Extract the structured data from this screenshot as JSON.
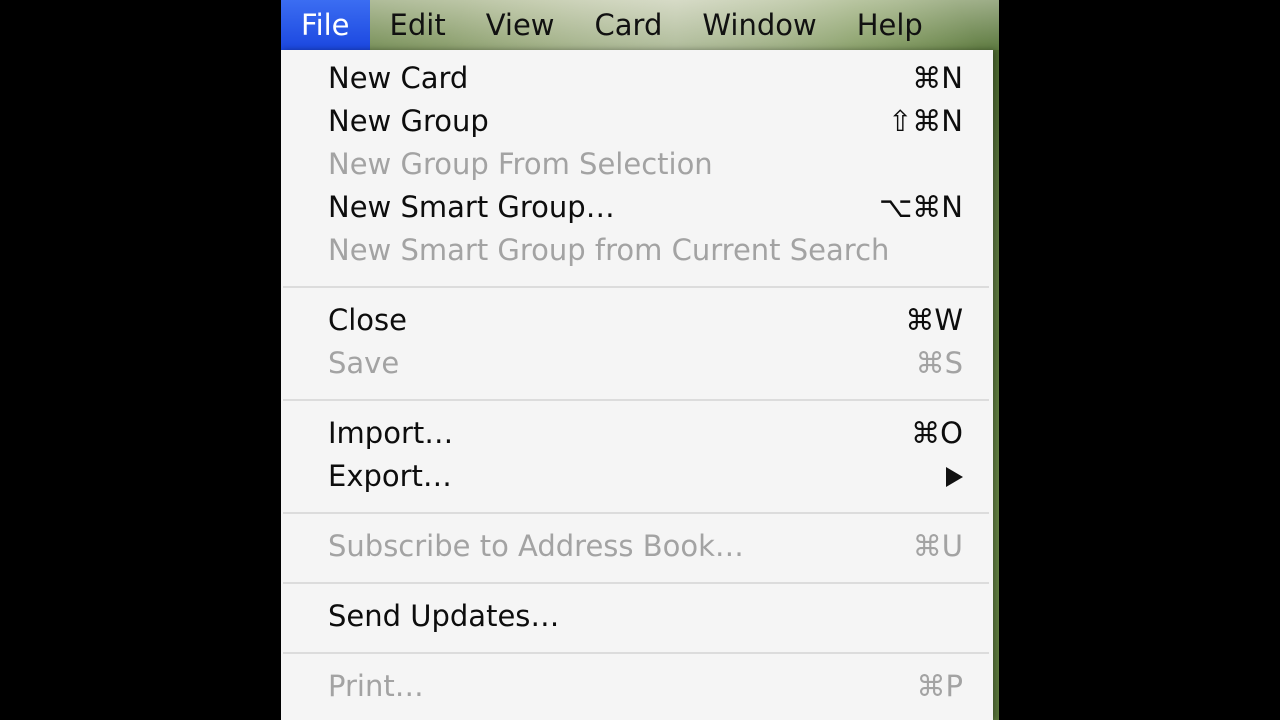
{
  "menubar": {
    "items": [
      {
        "label": "File",
        "active": true
      },
      {
        "label": "Edit",
        "active": false
      },
      {
        "label": "View",
        "active": false
      },
      {
        "label": "Card",
        "active": false
      },
      {
        "label": "Window",
        "active": false
      },
      {
        "label": "Help",
        "active": false
      }
    ]
  },
  "file_menu": {
    "items": [
      {
        "label": "New Card",
        "shortcut": "⌘N",
        "enabled": true
      },
      {
        "label": "New Group",
        "shortcut": "⇧⌘N",
        "enabled": true
      },
      {
        "label": "New Group From Selection",
        "shortcut": "",
        "enabled": false
      },
      {
        "label": "New Smart Group…",
        "shortcut": "⌥⌘N",
        "enabled": true
      },
      {
        "label": "New Smart Group from Current Search",
        "shortcut": "",
        "enabled": false
      },
      {
        "label": "Close",
        "shortcut": "⌘W",
        "enabled": true
      },
      {
        "label": "Save",
        "shortcut": "⌘S",
        "enabled": false
      },
      {
        "label": "Import…",
        "shortcut": "⌘O",
        "enabled": true
      },
      {
        "label": "Export…",
        "shortcut": "",
        "enabled": true,
        "submenu": true
      },
      {
        "label": "Subscribe to Address Book…",
        "shortcut": "⌘U",
        "enabled": false
      },
      {
        "label": "Send Updates…",
        "shortcut": "",
        "enabled": true
      },
      {
        "label": "Print…",
        "shortcut": "⌘P",
        "enabled": false
      }
    ]
  },
  "colors": {
    "highlight": "#1b47e0",
    "menu_background": "#f5f5f5",
    "disabled_text": "#a3a3a3",
    "enabled_text": "#0d0d0d"
  },
  "icons": {
    "export_submenu": "right-triangle-icon"
  }
}
